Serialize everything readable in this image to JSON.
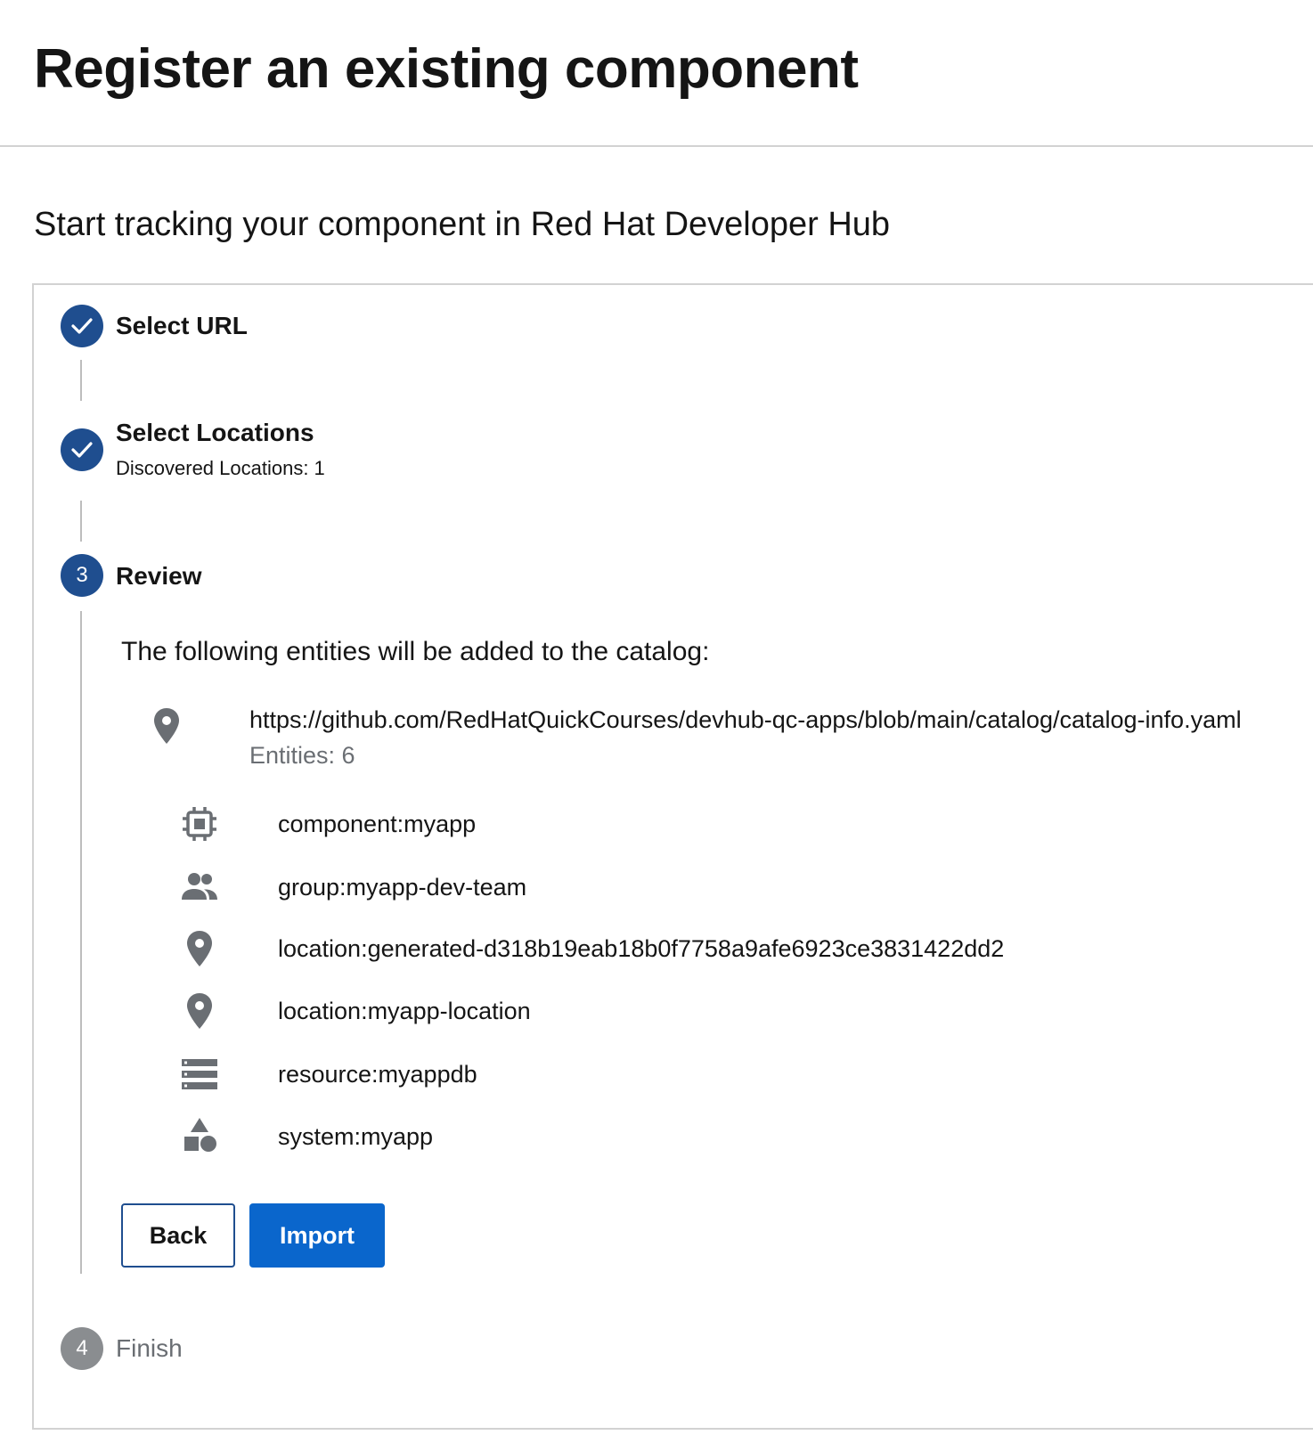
{
  "page": {
    "title": "Register an existing component",
    "subtitle": "Start tracking your component in Red Hat Developer Hub"
  },
  "colors": {
    "step_complete": "#1f4e8f",
    "step_pending": "#8a8d90",
    "primary_button": "#0a66cc"
  },
  "steps": [
    {
      "label": "Select URL",
      "status": "completed",
      "icon": "check-icon"
    },
    {
      "label": "Select Locations",
      "status": "completed",
      "icon": "check-icon",
      "sublabel": "Discovered Locations: 1"
    },
    {
      "label": "Review",
      "status": "active",
      "number": "3"
    },
    {
      "label": "Finish",
      "status": "pending",
      "number": "4"
    }
  ],
  "review": {
    "intro": "The following entities will be added to the catalog:",
    "location": {
      "url": "https://github.com/RedHatQuickCourses/devhub-qc-apps/blob/main/catalog/catalog-info.yaml",
      "entities_count": "Entities: 6",
      "icon": "location-pin-icon"
    },
    "entities": [
      {
        "label": "component:myapp",
        "icon": "component-chip-icon"
      },
      {
        "label": "group:myapp-dev-team",
        "icon": "group-people-icon"
      },
      {
        "label": "location:generated-d318b19eab18b0f7758a9afe6923ce3831422dd2",
        "icon": "location-pin-icon"
      },
      {
        "label": "location:myapp-location",
        "icon": "location-pin-icon"
      },
      {
        "label": "resource:myappdb",
        "icon": "resource-storage-icon"
      },
      {
        "label": "system:myapp",
        "icon": "system-shapes-icon"
      }
    ],
    "buttons": {
      "back": "Back",
      "import": "Import"
    }
  }
}
